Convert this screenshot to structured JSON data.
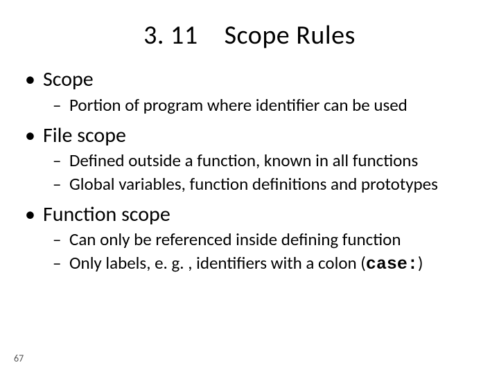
{
  "title": {
    "number": "3. 11",
    "text": "Scope Rules"
  },
  "items": [
    {
      "label": "Scope",
      "subs": [
        "Portion of program where identifier can be used"
      ]
    },
    {
      "label": "File scope",
      "subs": [
        "Defined outside a function, known in all functions",
        "Global variables, function definitions and prototypes"
      ]
    },
    {
      "label": "Function scope",
      "subs": [
        "Can only be referenced inside defining function",
        "Only labels, e. g. , identifiers with a colon (<mono>case:</mono>)"
      ]
    }
  ],
  "page_number": "67"
}
